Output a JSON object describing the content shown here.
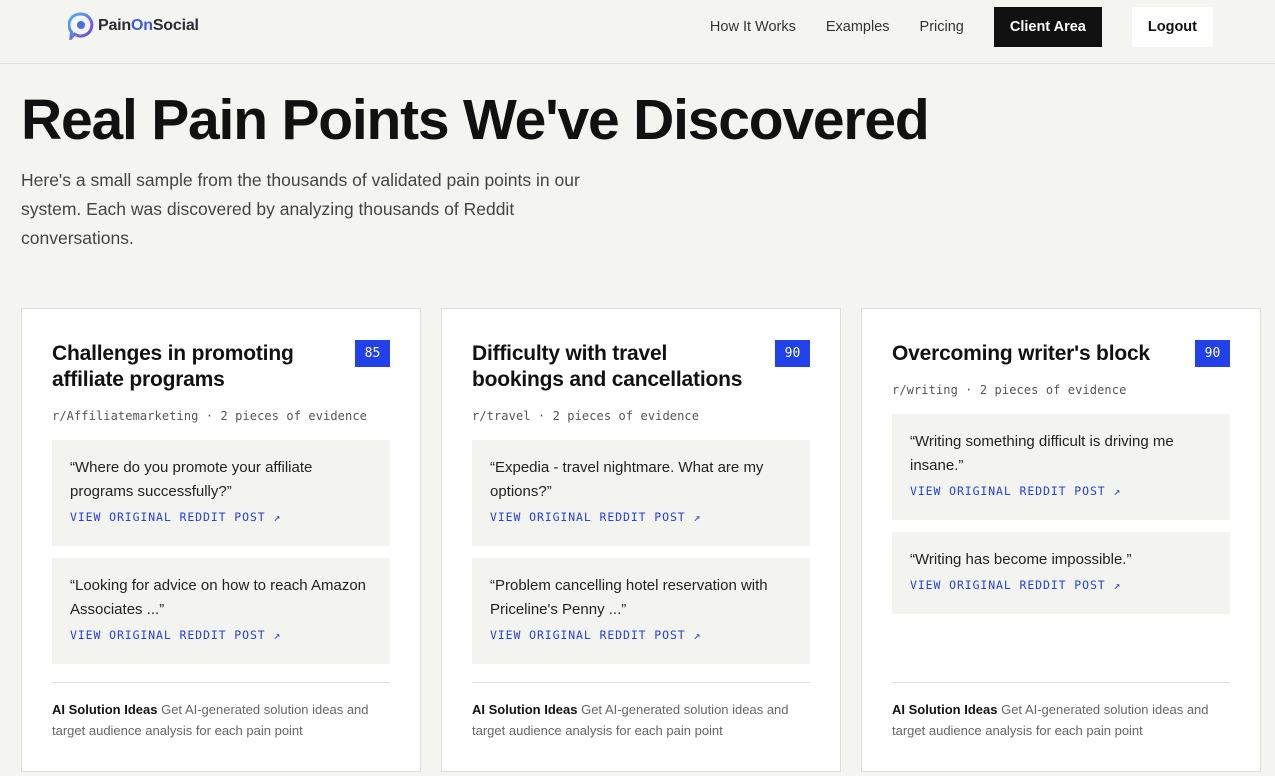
{
  "header": {
    "logo": {
      "part1": "Pain",
      "part2": "On",
      "part3": "Social"
    },
    "nav": [
      "How It Works",
      "Examples",
      "Pricing"
    ],
    "client_area_label": "Client Area",
    "logout_label": "Logout"
  },
  "hero": {
    "title": "Real Pain Points We've Discovered",
    "subtitle": "Here's a small sample from the thousands of validated pain points in our system. Each was discovered by analyzing thousands of Reddit conversations."
  },
  "colors": {
    "accent": "#2241e8",
    "dark_button": "#111111",
    "background": "#f4f4f0"
  },
  "cards": [
    {
      "title": "Challenges in promoting affiliate programs",
      "score": "85",
      "subreddit": "r/Affiliatemarketing",
      "evidence_count": "2 pieces of evidence",
      "evidence": [
        {
          "quote": "“Where do you promote your affiliate programs successfully?”",
          "link": "VIEW ORIGINAL REDDIT POST ↗"
        },
        {
          "quote": "“Looking for advice on how to reach Amazon Associates ...”",
          "link": "VIEW ORIGINAL REDDIT POST ↗"
        }
      ],
      "ai_label": "AI Solution Ideas",
      "ai_text": "Get AI-generated solution ideas and target audience analysis for each pain point"
    },
    {
      "title": "Difficulty with travel bookings and cancellations",
      "score": "90",
      "subreddit": "r/travel",
      "evidence_count": "2 pieces of evidence",
      "evidence": [
        {
          "quote": "“Expedia - travel nightmare. What are my options?”",
          "link": "VIEW ORIGINAL REDDIT POST ↗"
        },
        {
          "quote": "“Problem cancelling hotel reservation with Priceline's Penny ...”",
          "link": "VIEW ORIGINAL REDDIT POST ↗"
        }
      ],
      "ai_label": "AI Solution Ideas",
      "ai_text": "Get AI-generated solution ideas and target audience analysis for each pain point"
    },
    {
      "title": "Overcoming writer's block",
      "score": "90",
      "subreddit": "r/writing",
      "evidence_count": "2 pieces of evidence",
      "evidence": [
        {
          "quote": "“Writing something difficult is driving me insane.”",
          "link": "VIEW ORIGINAL REDDIT POST ↗"
        },
        {
          "quote": "“Writing has become impossible.”",
          "link": "VIEW ORIGINAL REDDIT POST ↗"
        }
      ],
      "ai_label": "AI Solution Ideas",
      "ai_text": "Get AI-generated solution ideas and target audience analysis for each pain point"
    }
  ]
}
